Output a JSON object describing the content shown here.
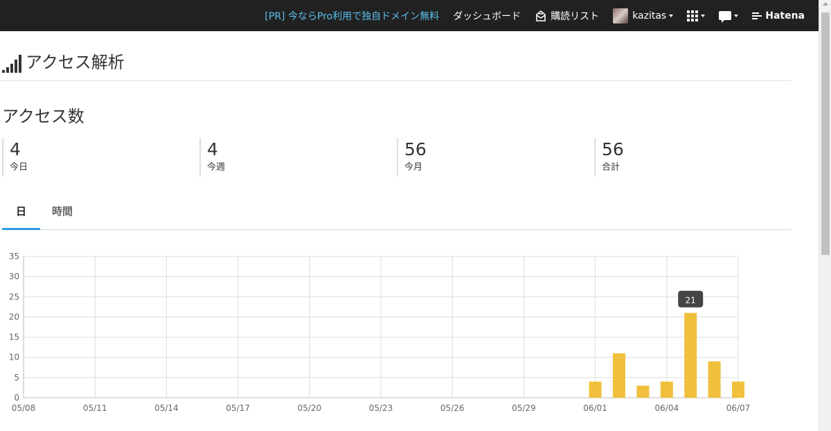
{
  "topbar": {
    "promo": "[PR] 今ならPro利用で独自ドメイン無料",
    "dashboard": "ダッシュボード",
    "subscriptions": "購読リスト",
    "username": "kazitas",
    "brand": "Hatena",
    "icons": [
      "subscription-icon",
      "avatar",
      "grid-menu-icon",
      "chat-icon",
      "hatena-logo-icon"
    ]
  },
  "page": {
    "title": "アクセス解析",
    "section_title": "アクセス数"
  },
  "stats": [
    {
      "value": "4",
      "label": "今日"
    },
    {
      "value": "4",
      "label": "今週"
    },
    {
      "value": "56",
      "label": "今月"
    },
    {
      "value": "56",
      "label": "合計"
    }
  ],
  "tabs": [
    {
      "label": "日",
      "active": true
    },
    {
      "label": "時間",
      "active": false
    }
  ],
  "colors": {
    "topbar_bg": "#212121",
    "promo": "#5bc0eb",
    "bar": "#f0c03c",
    "tab_active": "#2b9be0",
    "tooltip_bg": "#444444"
  },
  "chart_data": {
    "type": "bar",
    "x_dates": [
      "05/08",
      "05/09",
      "05/10",
      "05/11",
      "05/12",
      "05/13",
      "05/14",
      "05/15",
      "05/16",
      "05/17",
      "05/18",
      "05/19",
      "05/20",
      "05/21",
      "05/22",
      "05/23",
      "05/24",
      "05/25",
      "05/26",
      "05/27",
      "05/28",
      "05/29",
      "05/30",
      "05/31",
      "06/01",
      "06/02",
      "06/03",
      "06/04",
      "06/05",
      "06/06",
      "06/07"
    ],
    "values": [
      0,
      0,
      0,
      0,
      0,
      0,
      0,
      0,
      0,
      0,
      0,
      0,
      0,
      0,
      0,
      0,
      0,
      0,
      0,
      0,
      0,
      0,
      0,
      0,
      4,
      11,
      3,
      4,
      21,
      9,
      4
    ],
    "tick_labels": [
      "05/08",
      "05/11",
      "05/14",
      "05/17",
      "05/20",
      "05/23",
      "05/26",
      "05/29",
      "06/01",
      "06/04",
      "06/07"
    ],
    "y_ticks": [
      0,
      5,
      10,
      15,
      20,
      25,
      30,
      35
    ],
    "ylim": [
      0,
      35
    ],
    "grid": true,
    "tooltip": {
      "date": "06/05",
      "value": "21"
    }
  }
}
